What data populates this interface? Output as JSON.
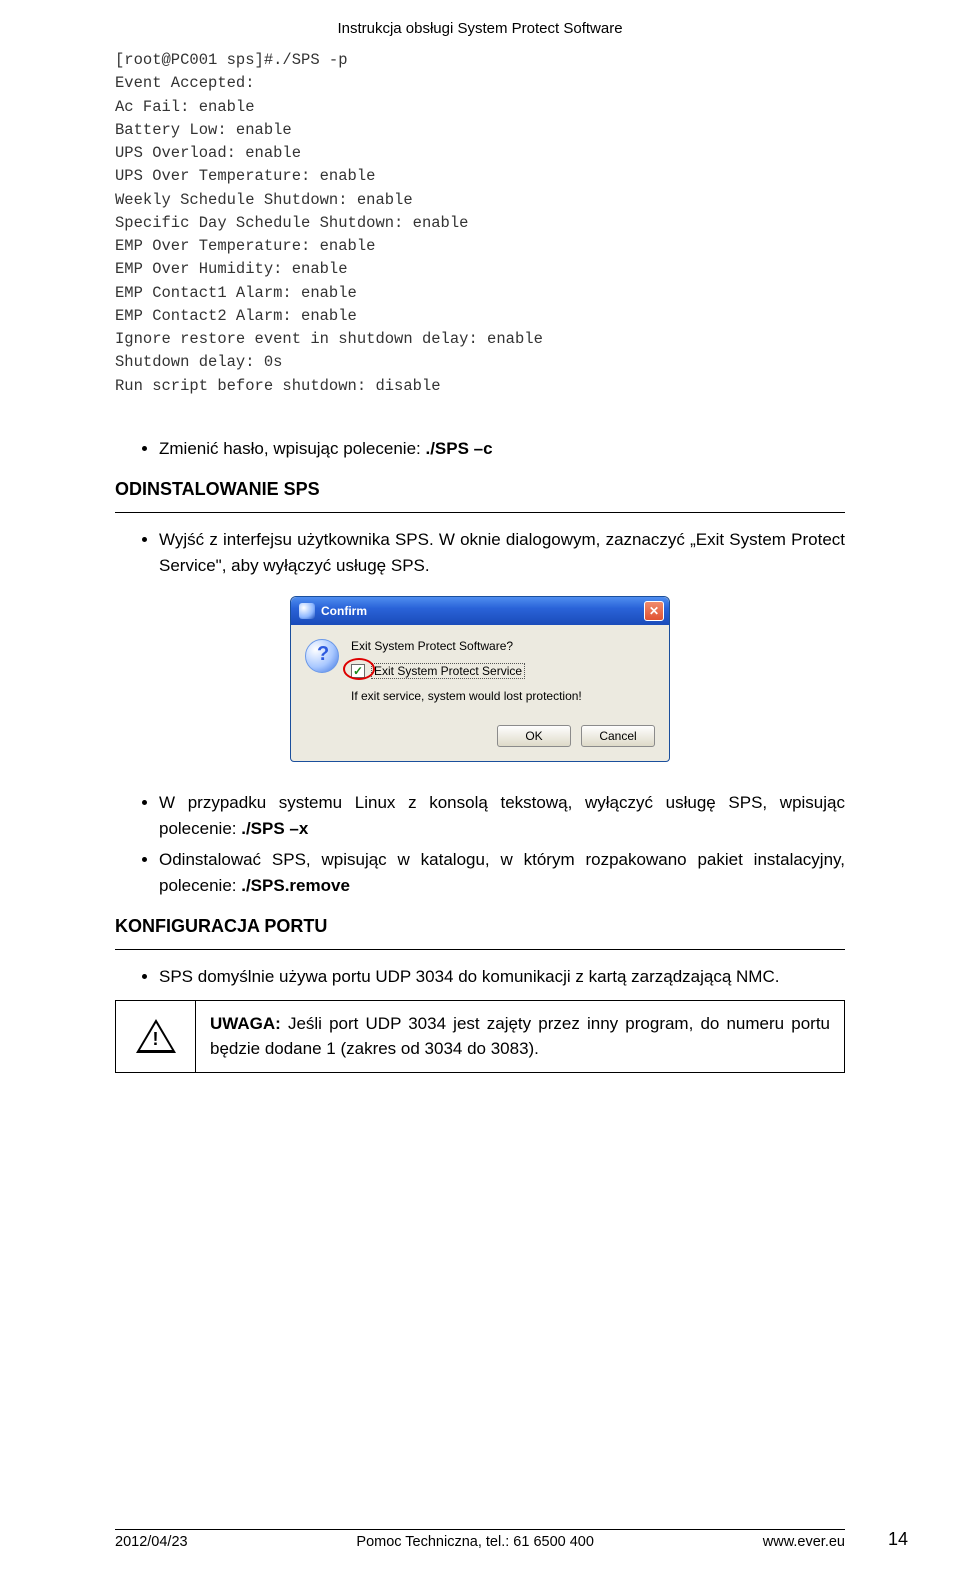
{
  "header": {
    "title": "Instrukcja obsługi System Protect Software"
  },
  "terminal": {
    "lines": [
      "[root@PC001 sps]#./SPS -p",
      "Event Accepted:",
      "Ac Fail: enable",
      "Battery Low: enable",
      "UPS Overload: enable",
      "UPS Over Temperature: enable",
      "Weekly Schedule Shutdown: enable",
      "Specific Day Schedule Shutdown: enable",
      "EMP Over Temperature: enable",
      "EMP Over Humidity: enable",
      "EMP Contact1 Alarm: enable",
      "EMP Contact2 Alarm: enable",
      "",
      "Ignore restore event in shutdown delay: enable",
      "Shutdown delay: 0s",
      "",
      "Run script before shutdown: disable"
    ]
  },
  "bullets1": {
    "i0_pre": "Zmienić hasło, wpisując polecenie: ",
    "i0_cmd": "./SPS –c"
  },
  "section_uninstall": "ODINSTALOWANIE SPS",
  "bullets2": {
    "i0": "Wyjść z interfejsu użytkownika SPS. W oknie dialogowym, zaznaczyć „Exit System Protect Service\", aby wyłączyć usługę SPS."
  },
  "dialog": {
    "title": "Confirm",
    "line1": "Exit System Protect Software?",
    "checkbox_label": "Exit System Protect Service",
    "line2": "If exit service, system would lost protection!",
    "ok": "OK",
    "cancel": "Cancel"
  },
  "bullets3": {
    "i0_pre": "W przypadku systemu Linux z konsolą tekstową, wyłączyć usługę SPS, wpisując polecenie: ",
    "i0_cmd": "./SPS –x",
    "i1_pre": "Odinstalować SPS, wpisując w katalogu, w którym rozpakowano pakiet instalacyjny, polecenie: ",
    "i1_cmd": "./SPS.remove"
  },
  "section_port": "KONFIGURACJA PORTU",
  "bullets4": {
    "i0": "SPS domyślnie używa portu UDP 3034 do komunikacji z kartą zarządzającą NMC."
  },
  "warning": {
    "label": "UWAGA:",
    "text": " Jeśli port UDP 3034 jest zajęty przez inny program, do numeru portu będzie dodane 1 (zakres od 3034 do 3083)."
  },
  "footer": {
    "date": "2012/04/23",
    "mid": "Pomoc Techniczna, tel.: 61 6500 400",
    "url": "www.ever.eu",
    "page": "14"
  }
}
